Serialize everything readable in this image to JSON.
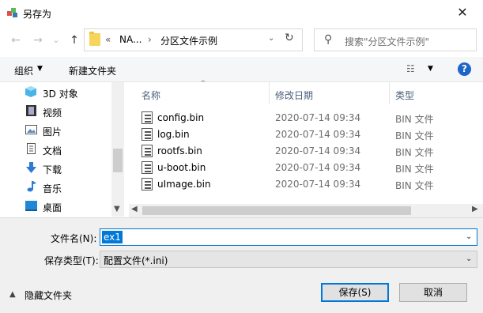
{
  "window": {
    "title": "另存为",
    "close_symbol": "✕"
  },
  "address_bar": {
    "back": "←",
    "forward": "→",
    "recent": "⌄",
    "up": "↑",
    "overflow": "«",
    "segments": [
      "NA...",
      "分区文件示例"
    ],
    "separator": "›",
    "dropdown": "⌄",
    "refresh": "↻"
  },
  "search": {
    "placeholder": "搜索\"分区文件示例\""
  },
  "toolbar": {
    "organize": "组织",
    "new_folder": "新建文件夹",
    "view_symbol": "☷",
    "help": "?"
  },
  "sidebar": {
    "items": [
      {
        "label": "3D 对象",
        "icon": "3d-objects-icon"
      },
      {
        "label": "视频",
        "icon": "video-icon"
      },
      {
        "label": "图片",
        "icon": "pictures-icon"
      },
      {
        "label": "文档",
        "icon": "documents-icon"
      },
      {
        "label": "下载",
        "icon": "download-icon"
      },
      {
        "label": "音乐",
        "icon": "music-icon"
      },
      {
        "label": "桌面",
        "icon": "desktop-icon"
      }
    ]
  },
  "file_list": {
    "columns": [
      "名称",
      "修改日期",
      "类型"
    ],
    "files": [
      {
        "name": "config.bin",
        "date": "2020-07-14 09:34",
        "type": "BIN 文件"
      },
      {
        "name": "log.bin",
        "date": "2020-07-14 09:34",
        "type": "BIN 文件"
      },
      {
        "name": "rootfs.bin",
        "date": "2020-07-14 09:34",
        "type": "BIN 文件"
      },
      {
        "name": "u-boot.bin",
        "date": "2020-07-14 09:34",
        "type": "BIN 文件"
      },
      {
        "name": "uImage.bin",
        "date": "2020-07-14 09:34",
        "type": "BIN 文件"
      }
    ]
  },
  "form": {
    "filename_label": "文件名(N):",
    "filename_value": "ex1",
    "filetype_label": "保存类型(T):",
    "filetype_value": "配置文件(*.ini)"
  },
  "footer": {
    "hide_folders": "隐藏文件夹",
    "save": "保存(S)",
    "cancel": "取消"
  },
  "colors": {
    "accent": "#0078d7",
    "help": "#1e65c8",
    "folder": "#f6d55c"
  }
}
